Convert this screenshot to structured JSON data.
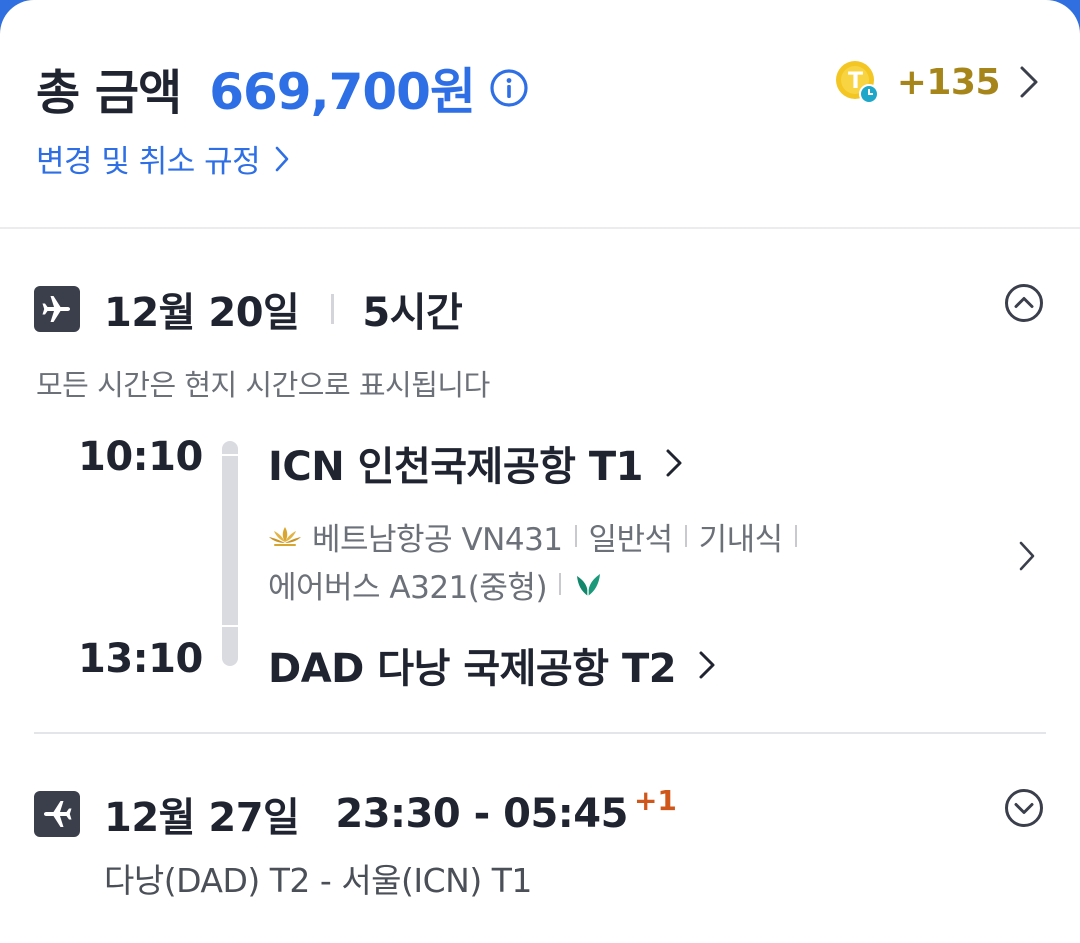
{
  "summary": {
    "total_label": "총 금액",
    "total_amount": "669,700원",
    "points": "+135",
    "coin_letter": "T",
    "policy_link": "변경 및 취소 규정"
  },
  "outbound": {
    "date": "12월 20일",
    "duration": "5시간",
    "timezone_note": "모든 시간은 현지 시간으로 표시됩니다",
    "departure": {
      "time": "10:10",
      "airport": "ICN  인천국제공항 T1"
    },
    "arrival": {
      "time": "13:10",
      "airport": "DAD  다낭 국제공항 T2"
    },
    "flight": {
      "airline_flight": "베트남항공 VN431",
      "cabin": "일반석",
      "meal": "기내식",
      "aircraft": "에어버스 A321(중형)"
    },
    "expanded": true
  },
  "return": {
    "date": "12월 27일",
    "times": "23:30 - 05:45",
    "day_offset": "+1",
    "route": "다낭(DAD) T2 - 서울(ICN) T1",
    "expanded": false
  },
  "colors": {
    "accent": "#2e6fe6",
    "points": "#a6861b",
    "day_offset": "#d0571b"
  }
}
